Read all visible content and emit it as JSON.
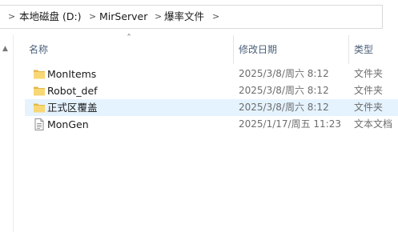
{
  "breadcrumb": {
    "items": [
      "本地磁盘 (D:)",
      "MirServer",
      "爆率文件"
    ],
    "separator": ">"
  },
  "columns": {
    "name": "名称",
    "date": "修改日期",
    "type": "类型"
  },
  "files": [
    {
      "name": "MonItems",
      "date": "2025/3/8/周六 8:12",
      "type": "文件夹",
      "icon": "folder-icon",
      "selected": false
    },
    {
      "name": "Robot_def",
      "date": "2025/3/8/周六 8:12",
      "type": "文件夹",
      "icon": "folder-icon",
      "selected": false
    },
    {
      "name": "正式区覆盖",
      "date": "2025/3/8/周六 8:12",
      "type": "文件夹",
      "icon": "folder-icon",
      "selected": true
    },
    {
      "name": "MonGen",
      "date": "2025/1/17/周五 11:23",
      "type": "文本文档",
      "icon": "text-document-icon",
      "selected": false
    }
  ],
  "colors": {
    "folder": "#f8d775",
    "folder_dark": "#e5b94c",
    "selection": "#e5f3ff",
    "header_text": "#4c607a"
  }
}
